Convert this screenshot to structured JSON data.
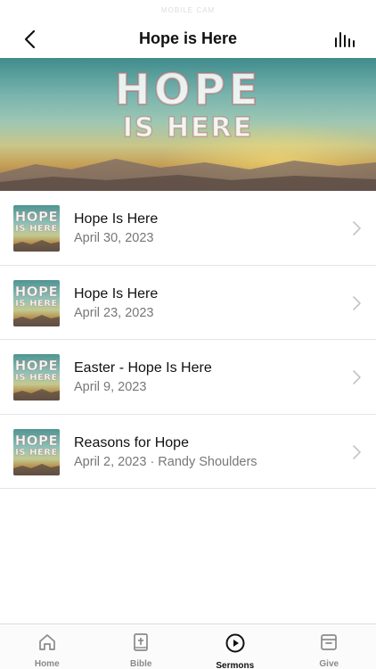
{
  "status_bar": {
    "text": "MOBILE CAM"
  },
  "nav": {
    "title": "Hope is Here",
    "back_icon": "chevron-left-icon",
    "right_icon": "audio-bars-icon"
  },
  "hero": {
    "line1": "HOPE",
    "line2": "IS HERE"
  },
  "thumb_art": {
    "line1": "HOPE",
    "line2": "IS HERE"
  },
  "sermons": [
    {
      "title": "Hope Is Here",
      "subtitle": "April 30, 2023"
    },
    {
      "title": "Hope Is Here",
      "subtitle": "April 23, 2023"
    },
    {
      "title": "Easter - Hope Is Here",
      "subtitle": "April 9, 2023"
    },
    {
      "title": "Reasons for Hope",
      "subtitle": "April 2, 2023 · Randy Shoulders"
    }
  ],
  "tabs": [
    {
      "label": "Home",
      "icon": "home-icon",
      "active": false
    },
    {
      "label": "Bible",
      "icon": "bible-icon",
      "active": false
    },
    {
      "label": "Sermons",
      "icon": "play-circle-icon",
      "active": true
    },
    {
      "label": "Give",
      "icon": "archive-box-icon",
      "active": false
    }
  ],
  "colors": {
    "active": "#111111",
    "inactive": "#8a8a8a",
    "divider": "#e5e5e5"
  }
}
